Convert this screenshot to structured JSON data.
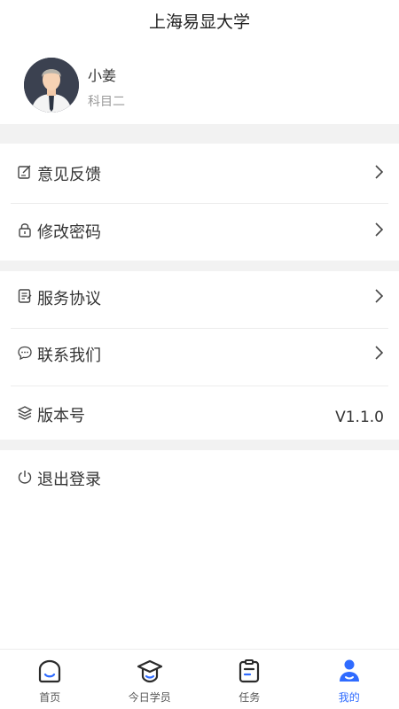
{
  "header": {
    "title": "上海易显大学"
  },
  "profile": {
    "name": "小姜",
    "subtitle": "科目二"
  },
  "menu": {
    "feedback": "意见反馈",
    "change_password": "修改密码",
    "service_agreement": "服务协议",
    "contact_us": "联系我们",
    "version_label": "版本号",
    "version_value": "V1.1.0",
    "logout": "退出登录"
  },
  "tabs": [
    {
      "label": "首页",
      "icon": "home-icon",
      "active": false
    },
    {
      "label": "今日学员",
      "icon": "graduation-cap-icon",
      "active": false
    },
    {
      "label": "任务",
      "icon": "clipboard-icon",
      "active": false
    },
    {
      "label": "我的",
      "icon": "user-icon",
      "active": true
    }
  ],
  "colors": {
    "accent": "#2f6bff",
    "background_gap": "#f2f2f2",
    "text": "#333333",
    "muted": "#999999"
  }
}
